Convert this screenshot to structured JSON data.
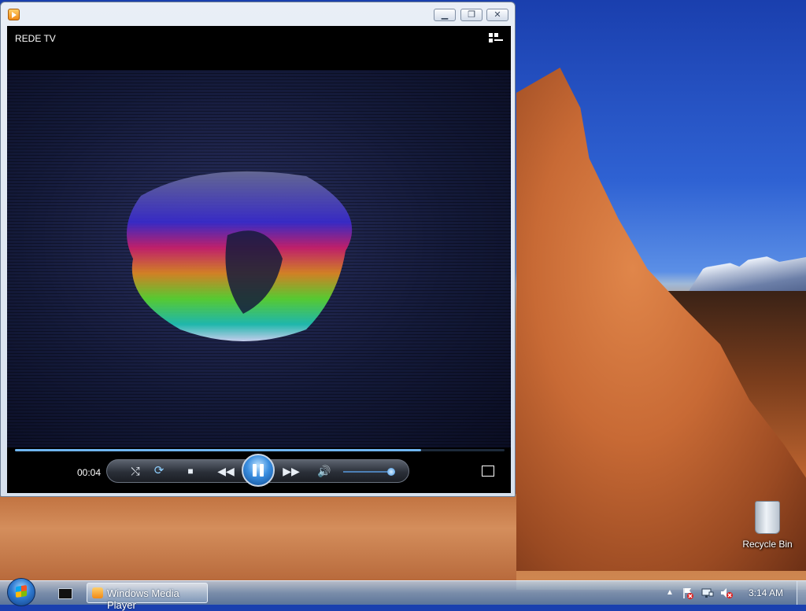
{
  "window": {
    "title": "",
    "app_icon": "windows-media-player-icon",
    "controls": {
      "minimize": "minimize-icon",
      "maximize": "restore-icon",
      "close": "close-icon"
    }
  },
  "player": {
    "channel_title": "REDE TV",
    "time_elapsed": "00:04",
    "seek_progress": 0.83,
    "volume_level": 0.92,
    "state": "playing",
    "icons": [
      "shuffle-icon",
      "repeat-icon",
      "stop-icon",
      "previous-icon",
      "pause-icon",
      "next-icon",
      "volume-icon",
      "fullscreen-icon",
      "switch-to-library-icon"
    ]
  },
  "desktop": {
    "icons": [
      {
        "label": "Recycle Bin",
        "icon": "recycle-bin-icon"
      }
    ]
  },
  "taskbar": {
    "running_task_label": "Windows Media Player",
    "clock": "3:14 AM",
    "tray_icons": [
      "show-hidden-icons-arrow",
      "action-center-flag-icon",
      "network-icon",
      "volume-muted-icon"
    ]
  },
  "colors": {
    "accent": "#3a8ee0",
    "video_bg": "#000000",
    "seek_fill": "#6fb5f0"
  }
}
